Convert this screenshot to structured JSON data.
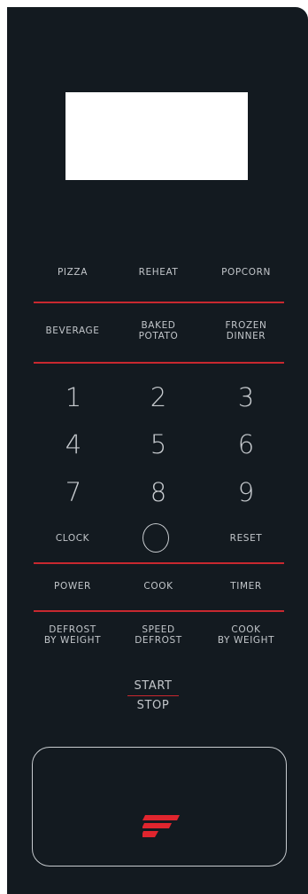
{
  "panel": {
    "accent_color": "#c8282f",
    "background_color": "#131a20",
    "text_color": "#c2c6ca"
  },
  "display": {
    "text": ""
  },
  "presets_row1": {
    "pizza": "PIZZA",
    "reheat": "REHEAT",
    "popcorn": "POPCORN"
  },
  "presets_row2": {
    "beverage": "BEVERAGE",
    "baked_potato": [
      "BAKED",
      "POTATO"
    ],
    "frozen_dinner": [
      "FROZEN",
      "DINNER"
    ]
  },
  "keypad": {
    "digits": [
      "1",
      "2",
      "3",
      "4",
      "5",
      "6",
      "7",
      "8",
      "9"
    ],
    "zero": "0",
    "clock": "CLOCK",
    "reset": "RESET"
  },
  "function_row": {
    "power": "POWER",
    "cook": "COOK",
    "timer": "TIMER"
  },
  "defrost_row": {
    "defrost_by_weight": [
      "DEFROST",
      "BY WEIGHT"
    ],
    "speed_defrost": [
      "SPEED",
      "DEFROST"
    ],
    "cook_by_weight": [
      "COOK",
      "BY WEIGHT"
    ]
  },
  "start_stop": {
    "start": "START",
    "stop": "STOP"
  },
  "door_button": {
    "icon": "brand-logo-icon"
  }
}
